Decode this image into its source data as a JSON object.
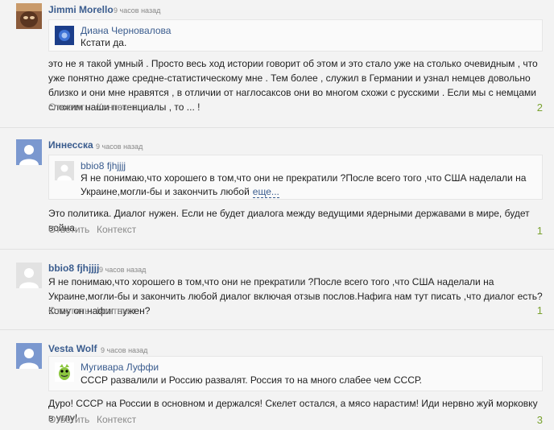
{
  "comments": [
    {
      "author": "Jimmi Morello",
      "time": "9 часов назад",
      "quote": {
        "author": "Диана Черновалова",
        "text": "Кстати да."
      },
      "text": "это не я такой умный . Просто весь ход истории говорит об этом и это стало уже на столько очевидным , что уже понятно даже средне-статистическому мне . Тем более , служил в Германии и узнал немцев довольно близко и они мне нравятся , в отличии от наглосаксов они во многом схожи с русскими . Если мы с немцами сложим наши потенциалы , то ... !",
      "reply": "Ответить",
      "context": "Контекст",
      "count": "2"
    },
    {
      "author": "Иннесска",
      "time": "9 часов назад",
      "quote": {
        "author": "bbio8 fjhjjjj",
        "text": "Я не понимаю,что хорошего в том,что они не прекратили ?После всего того ,что США наделали на Украине,могли-бы и закончить любой",
        "more": "еще..."
      },
      "text": "Это политика. Диалог нужен. Если не будет диалога между ведущими ядерными державами в мире, будет война.",
      "reply": "Ответить",
      "context": "Контекст",
      "count": "1"
    },
    {
      "author": "bbio8 fjhjjjj",
      "time": "9 часов назад",
      "text": "Я не понимаю,что хорошего в том,что они не прекратили ?После всего того ,что США наделали на Украине,могли-бы и закончить любой диалог включая отзыв послов.Нафига нам тут писать ,что диалог есть?Кому он нафиг нужен?",
      "reply": "Ответить",
      "context": "Контекст",
      "count": "1"
    },
    {
      "author": "Vesta Wolf",
      "time": "9 часов назад",
      "quote": {
        "author": "Мугивара Луффи",
        "text": "СССР развалили и Россию развалят. Россия то на много слабее чем СССР."
      },
      "text": "Дуро! СССР на России в основном и держался! Скелет остался, а мясо нарастим! Иди нервно жуй морковку в углу!",
      "reply": "Ответить",
      "context": "Контекст",
      "count": "3"
    }
  ]
}
